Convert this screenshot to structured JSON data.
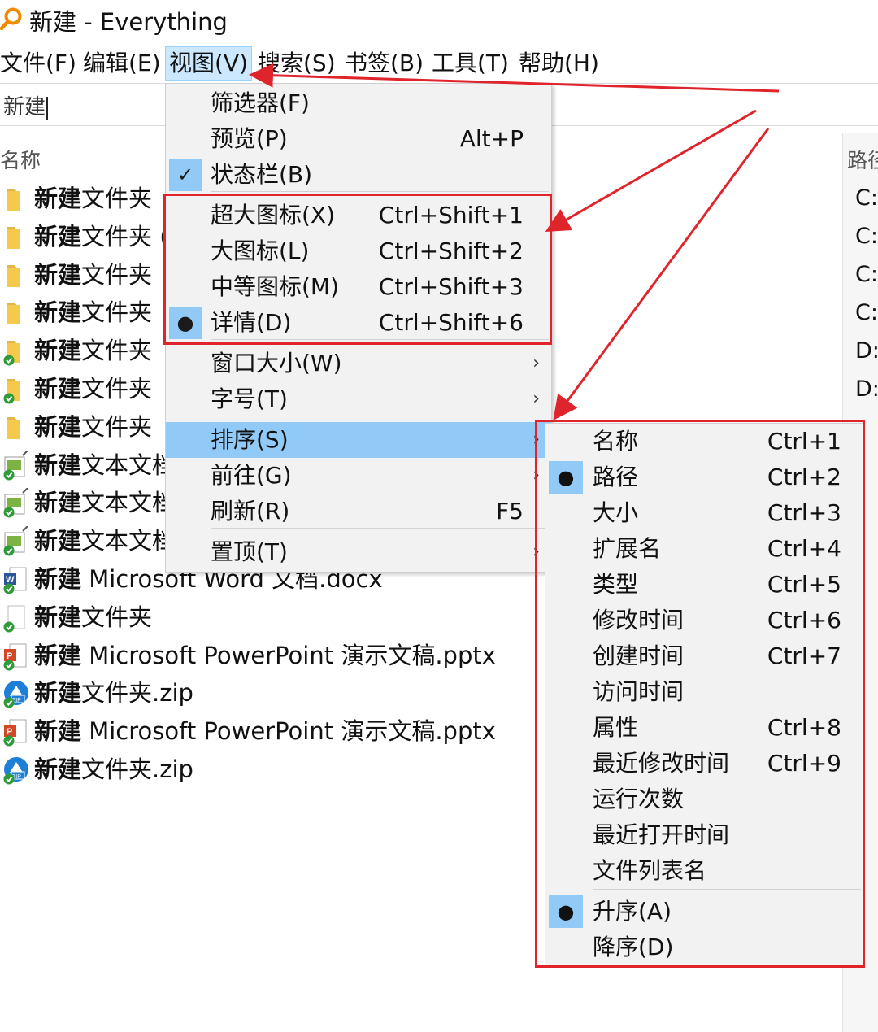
{
  "window": {
    "title": "新建 - Everything"
  },
  "menubar": {
    "items": [
      "文件(F)",
      "编辑(E)",
      "视图(V)",
      "搜索(S)",
      "书签(B)",
      "工具(T)",
      "帮助(H)"
    ],
    "active": "视图(V)"
  },
  "search": {
    "value": "新建"
  },
  "columns": {
    "name": "名称",
    "path": "路径"
  },
  "file_list": [
    {
      "bold": "新建",
      "rest": "文件夹",
      "icon": "folder-icon"
    },
    {
      "bold": "新建",
      "rest": "文件夹 (",
      "icon": "folder-icon"
    },
    {
      "bold": "新建",
      "rest": "文件夹",
      "icon": "folder-icon"
    },
    {
      "bold": "新建",
      "rest": "文件夹",
      "icon": "folder-icon"
    },
    {
      "bold": "新建",
      "rest": "文件夹",
      "icon": "synced-folder-icon"
    },
    {
      "bold": "新建",
      "rest": "文件夹",
      "icon": "synced-folder-icon"
    },
    {
      "bold": "新建",
      "rest": "文件夹",
      "icon": "folder-icon"
    },
    {
      "bold": "新建",
      "rest": "文本文档",
      "icon": "text-document-icon"
    },
    {
      "bold": "新建",
      "rest": "文本文档",
      "icon": "text-document-icon"
    },
    {
      "bold": "新建",
      "rest": "文本文档",
      "icon": "text-document-icon"
    },
    {
      "bold": "新建",
      "rest": " Microsoft Word 文档.docx",
      "icon": "word-document-icon"
    },
    {
      "bold": "新建",
      "rest": "文件夹",
      "icon": "synced-file-icon"
    },
    {
      "bold": "新建",
      "rest": " Microsoft PowerPoint 演示文稿.pptx",
      "icon": "powerpoint-icon"
    },
    {
      "bold": "新建",
      "rest": "文件夹.zip",
      "icon": "zip-icon"
    },
    {
      "bold": "新建",
      "rest": " Microsoft PowerPoint 演示文稿.pptx",
      "icon": "powerpoint-icon"
    },
    {
      "bold": "新建",
      "rest": "文件夹.zip",
      "icon": "zip-icon"
    }
  ],
  "paths": [
    "C:\\",
    "C:\\",
    "C:\\",
    "C:\\",
    "D:",
    "D:"
  ],
  "view_menu": {
    "items": [
      {
        "label": "筛选器(F)",
        "shortcut": ""
      },
      {
        "label": "预览(P)",
        "shortcut": "Alt+P"
      },
      {
        "label": "状态栏(B)",
        "shortcut": "",
        "checked": true
      },
      {
        "label": "超大图标(X)",
        "shortcut": "Ctrl+Shift+1"
      },
      {
        "label": "大图标(L)",
        "shortcut": "Ctrl+Shift+2"
      },
      {
        "label": "中等图标(M)",
        "shortcut": "Ctrl+Shift+3"
      },
      {
        "label": "详情(D)",
        "shortcut": "Ctrl+Shift+6",
        "selected": true
      },
      {
        "label": "窗口大小(W)",
        "shortcut": "",
        "submenu": true
      },
      {
        "label": "字号(T)",
        "shortcut": "",
        "submenu": true
      },
      {
        "label": "排序(S)",
        "shortcut": "",
        "submenu": true,
        "highlighted": true
      },
      {
        "label": "前往(G)",
        "shortcut": "",
        "submenu": true
      },
      {
        "label": "刷新(R)",
        "shortcut": "F5"
      },
      {
        "label": "置顶(T)",
        "shortcut": "",
        "submenu": true
      }
    ]
  },
  "sort_menu": {
    "items": [
      {
        "label": "名称",
        "shortcut": "Ctrl+1"
      },
      {
        "label": "路径",
        "shortcut": "Ctrl+2",
        "selected": true
      },
      {
        "label": "大小",
        "shortcut": "Ctrl+3"
      },
      {
        "label": "扩展名",
        "shortcut": "Ctrl+4"
      },
      {
        "label": "类型",
        "shortcut": "Ctrl+5"
      },
      {
        "label": "修改时间",
        "shortcut": "Ctrl+6"
      },
      {
        "label": "创建时间",
        "shortcut": "Ctrl+7"
      },
      {
        "label": "访问时间",
        "shortcut": ""
      },
      {
        "label": "属性",
        "shortcut": "Ctrl+8"
      },
      {
        "label": "最近修改时间",
        "shortcut": "Ctrl+9"
      },
      {
        "label": "运行次数",
        "shortcut": ""
      },
      {
        "label": "最近打开时间",
        "shortcut": ""
      },
      {
        "label": "文件列表名",
        "shortcut": ""
      },
      {
        "label": "升序(A)",
        "shortcut": "",
        "selected": true
      },
      {
        "label": "降序(D)",
        "shortcut": ""
      }
    ]
  },
  "glyphs": {
    "check": "✓",
    "dot": "●",
    "submenu_arrow": "›"
  },
  "colors": {
    "highlight": "#91c9f7",
    "annotation_red": "#e0242b",
    "menu_bg": "#f2f2f2"
  }
}
